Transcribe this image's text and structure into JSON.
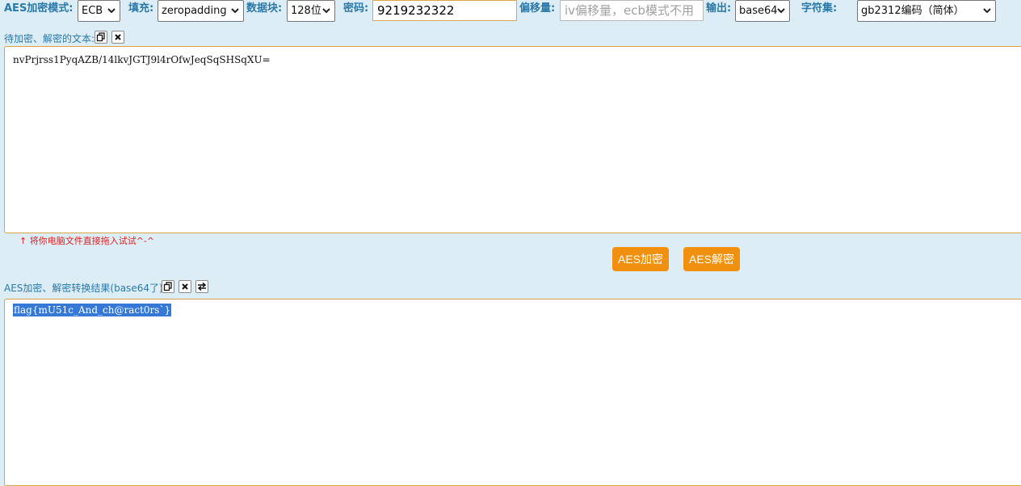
{
  "toolbar": {
    "mode_label": "AES加密模式:",
    "mode_value": "ECB",
    "padding_label": "填充:",
    "padding_value": "zeropadding",
    "block_label": "数据块:",
    "block_value": "128位",
    "key_label": "密码:",
    "key_value": "9219232322",
    "iv_label": "偏移量:",
    "iv_placeholder": "iv偏移量，ecb模式不用",
    "output_label": "输出:",
    "output_value": "base64",
    "charset_label": "字符集:",
    "charset_value": "gb2312编码（简体）"
  },
  "input_section": {
    "label": "待加密、解密的文本:",
    "text": "nvPrjrss1PyqAZB/14lkvJGTJ9l4rOfwJeqSqSHSqXU=",
    "copy_icon": "copy-icon",
    "clear_icon": "close-icon"
  },
  "hint": "↑ 将你电脑文件直接拖入试试^-^",
  "buttons": {
    "encrypt": "AES加密",
    "decrypt": "AES解密"
  },
  "output_section": {
    "label": "AES加密、解密转换结果(base64了):",
    "text": "flag{mU51c_And_ch@ract0rs`}",
    "copy_icon": "copy-icon",
    "clear_icon": "close-icon",
    "swap_icon": "swap-icon"
  },
  "colors": {
    "background": "#dcedf6",
    "label_blue": "#2a79a8",
    "button_orange": "#f0900e",
    "panel_border": "#d9a441",
    "hint_red": "#e02020",
    "selection_blue": "#3578d6"
  }
}
